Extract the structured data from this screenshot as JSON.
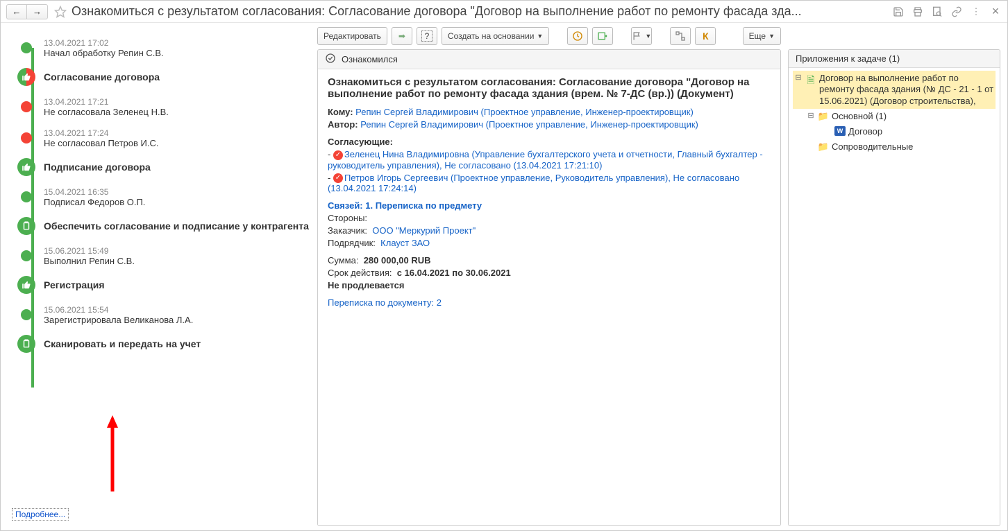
{
  "header": {
    "title": "Ознакомиться с результатом согласования: Согласование договора \"Договор  на  выполнение работ по ремонту фасада зда..."
  },
  "toolbar": {
    "edit": "Редактировать",
    "create_based": "Создать на основании",
    "more": "Еще",
    "k": "К"
  },
  "status": {
    "label": "Ознакомился"
  },
  "doc": {
    "title": "Ознакомиться с результатом согласования: Согласование договора \"Договор  на  выполнение работ по ремонту фасада здания (врем. № 7-ДС (вр.)) (Документ)",
    "to_label": "Кому:",
    "to_value": "Репин Сергей Владимирович (Проектное управление, Инженер-проектировщик)",
    "author_label": "Автор:",
    "author_value": "Репин Сергей Владимирович (Проектное управление, Инженер-проектировщик)",
    "approvers_label": "Согласующие:",
    "approver1": "Зеленец Нина Владимировна (Управление бухгалтерского учета и отчетности, Главный бухгалтер - руководитель управления), Не согласовано (13.04.2021 17:21:10)",
    "approver2": "Петров Игорь Сергеевич (Проектное управление, Руководитель управления), Не согласовано (13.04.2021 17:24:14)",
    "links_label": "Связей: 1. Переписка по предмету",
    "parties_label": "Стороны:",
    "customer_label": "Заказчик:",
    "customer_value": "ООО \"Меркурий Проект\"",
    "contractor_label": "Подрядчик:",
    "contractor_value": "Клауст ЗАО",
    "sum_label": "Сумма:",
    "sum_value": "280 000,00 RUB",
    "period_label": "Срок действия:",
    "period_value": "с 16.04.2021 по 30.06.2021",
    "noprolong": "Не продлевается",
    "corr_label": "Переписка по документу:",
    "corr_value": "2"
  },
  "timeline": {
    "more": "Подробнее...",
    "i0_meta": "13.04.2021 17:02",
    "i0_sub": "Начал обработку Репин С.В.",
    "i1_title": "Согласование договора",
    "i2_meta": "13.04.2021 17:21",
    "i2_sub": "Не согласовала Зеленец Н.В.",
    "i3_meta": "13.04.2021 17:24",
    "i3_sub": "Не согласовал Петров И.С.",
    "i4_title": "Подписание договора",
    "i5_meta": "15.04.2021 16:35",
    "i5_sub": "Подписал Федоров О.П.",
    "i6_title": "Обеспечить согласование и подписание у контрагента",
    "i7_meta": "15.06.2021 15:49",
    "i7_sub": "Выполнил Репин С.В.",
    "i8_title": "Регистрация",
    "i9_meta": "15.06.2021 15:54",
    "i9_sub": "Зарегистрировала Великанова Л.А.",
    "i10_title": "Сканировать и передать на учет"
  },
  "attach": {
    "header": "Приложения к задаче (1)",
    "n0": "Договор  на  выполнение работ по ремонту фасада здания (№ ДС - 21 - 1 от 15.06.2021) (Договор строительства),",
    "n1": "Основной (1)",
    "n2": "Договор",
    "n3": "Сопроводительные"
  }
}
